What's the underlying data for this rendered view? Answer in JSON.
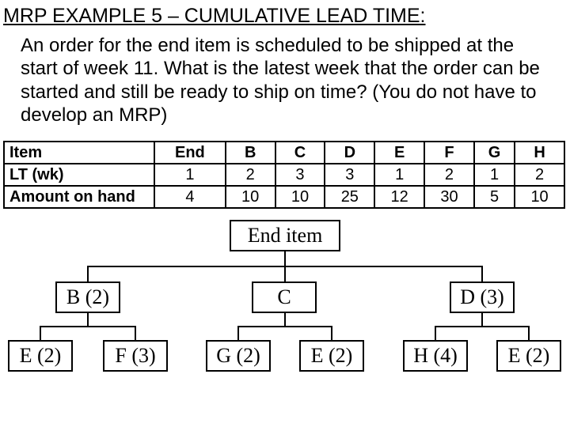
{
  "title": "MRP EXAMPLE 5 – CUMULATIVE LEAD TIME:",
  "body": "An order for the end item is scheduled to be shipped at the start of week 11.  What is the latest week that the order can be started and still be ready to ship on time? (You do not have to develop an MRP)",
  "table": {
    "rows": {
      "item": {
        "label": "Item",
        "cells": [
          "End",
          "B",
          "C",
          "D",
          "E",
          "F",
          "G",
          "H"
        ]
      },
      "lt": {
        "label": "LT (wk)",
        "cells": [
          "1",
          "2",
          "3",
          "3",
          "1",
          "2",
          "1",
          "2"
        ]
      },
      "onhand": {
        "label": "Amount on hand",
        "cells": [
          "4",
          "10",
          "10",
          "25",
          "12",
          "30",
          "5",
          "10"
        ]
      }
    }
  },
  "bom": {
    "root": "End item",
    "level1": {
      "b": "B (2)",
      "c": "C",
      "d": "D (3)"
    },
    "level2": {
      "e1": "E (2)",
      "f": "F (3)",
      "g": "G (2)",
      "e2": "E (2)",
      "h": "H (4)",
      "e3": "E (2)"
    }
  },
  "chart_data": {
    "type": "table",
    "title": "Lead time and on-hand inventory by item; BOM tree for End item",
    "items": [
      "End",
      "B",
      "C",
      "D",
      "E",
      "F",
      "G",
      "H"
    ],
    "lead_time_wk": [
      1,
      2,
      3,
      3,
      1,
      2,
      1,
      2
    ],
    "amount_on_hand": [
      4,
      10,
      10,
      25,
      12,
      30,
      5,
      10
    ],
    "bom_tree": {
      "End item": {
        "B": {
          "qty": 2,
          "children": {
            "E": {
              "qty": 2
            },
            "F": {
              "qty": 3
            }
          }
        },
        "C": {
          "qty": 1,
          "children": {
            "G": {
              "qty": 2
            },
            "E": {
              "qty": 2
            }
          }
        },
        "D": {
          "qty": 3,
          "children": {
            "H": {
              "qty": 4
            },
            "E": {
              "qty": 2
            }
          }
        }
      }
    }
  }
}
